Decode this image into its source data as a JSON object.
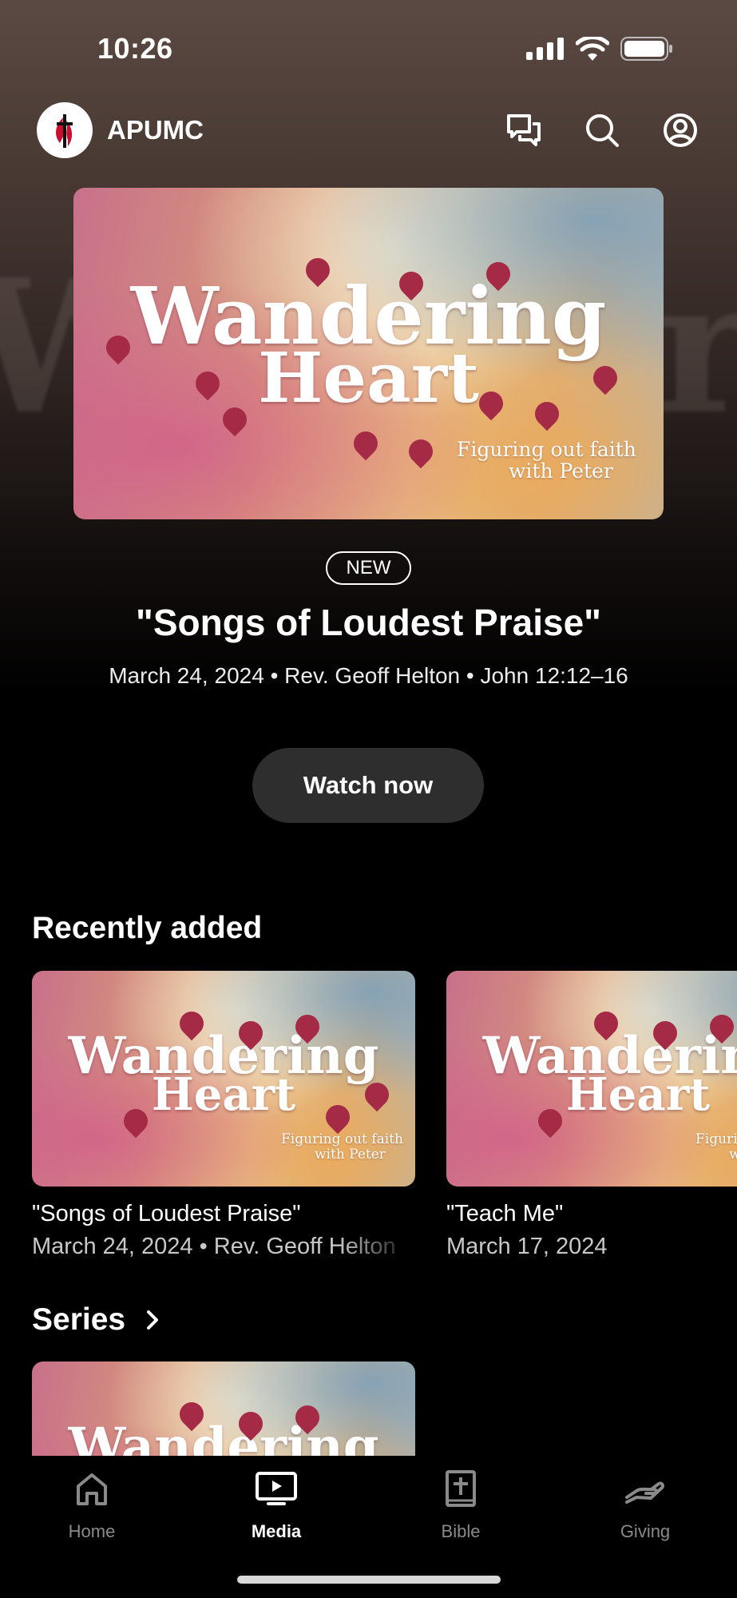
{
  "status_bar": {
    "time": "10:26"
  },
  "header": {
    "brand": "APUMC"
  },
  "artwork": {
    "title_line1": "Wandering",
    "title_line2": "Heart",
    "subtitle_line1": "Figuring out faith",
    "subtitle_line2": "with Peter"
  },
  "hero": {
    "badge": "NEW",
    "title": "\"Songs of Loudest Praise\"",
    "meta": "March 24, 2024 • Rev. Geoff Helton • John 12:12–16",
    "button": "Watch now"
  },
  "recently_added": {
    "title": "Recently added",
    "items": [
      {
        "title": "\"Songs of Loudest Praise\"",
        "meta": "March 24, 2024 • Rev. Geoff Helton"
      },
      {
        "title": "\"Teach Me\"",
        "meta": "March 17, 2024"
      }
    ]
  },
  "series": {
    "title": "Series",
    "chevron_icon": "chevron-right-icon"
  },
  "tabs": [
    {
      "label": "Home",
      "icon": "home-icon",
      "active": false
    },
    {
      "label": "Media",
      "icon": "tv-play-icon",
      "active": true
    },
    {
      "label": "Bible",
      "icon": "bible-icon",
      "active": false
    },
    {
      "label": "Giving",
      "icon": "giving-hand-icon",
      "active": false
    }
  ],
  "colors": {
    "accent_pin": "#a52a45",
    "button_bg": "#2e2e2e",
    "inactive_tab": "#8a8a8a"
  }
}
